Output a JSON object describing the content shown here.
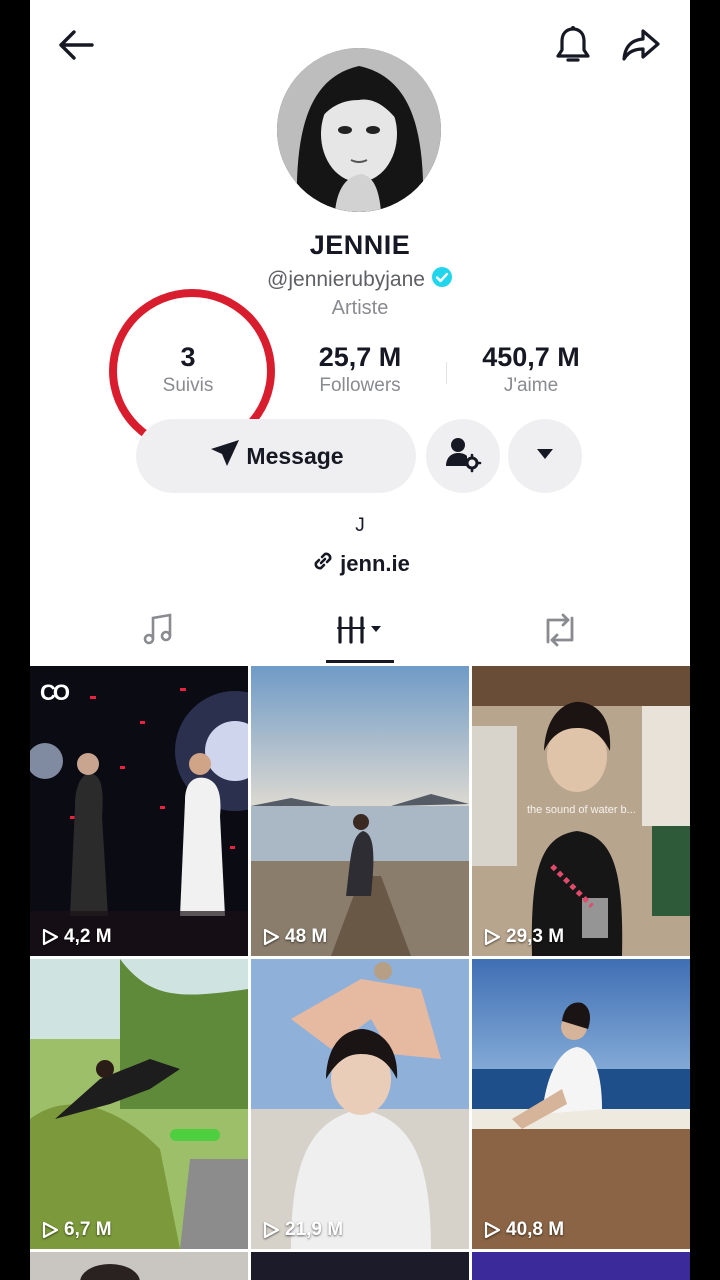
{
  "profile": {
    "name": "JENNIE",
    "handle": "@jennierubyjane",
    "category": "Artiste",
    "bio": "J",
    "link": "jenn.ie"
  },
  "stats": [
    {
      "value": "3",
      "label": "Suivis"
    },
    {
      "value": "25,7 M",
      "label": "Followers"
    },
    {
      "value": "450,7 M",
      "label": "J'aime"
    }
  ],
  "actions": {
    "message_label": "Message"
  },
  "icons": {
    "back": "arrow-left-icon",
    "notifications": "bell-icon",
    "share": "share-icon",
    "verified": "verified-badge-icon",
    "send": "send-icon",
    "add_friend": "person-gear-icon",
    "more": "caret-down-icon",
    "link": "link-icon",
    "tab_music": "music-note-icon",
    "tab_videos": "grid-icon",
    "tab_reposts": "repost-icon",
    "play": "play-icon"
  },
  "colors": {
    "accent_verified": "#20d5ec",
    "highlight_ring": "#d81e2e",
    "button_bg": "#efeff1"
  },
  "videos": [
    {
      "views": "4,2 M",
      "badge": "CO"
    },
    {
      "views": "48 M"
    },
    {
      "views": "29,3 M",
      "caption": "the sound of water b..."
    },
    {
      "views": "6,7 M"
    },
    {
      "views": "21,9 M"
    },
    {
      "views": "40,8 M"
    }
  ]
}
